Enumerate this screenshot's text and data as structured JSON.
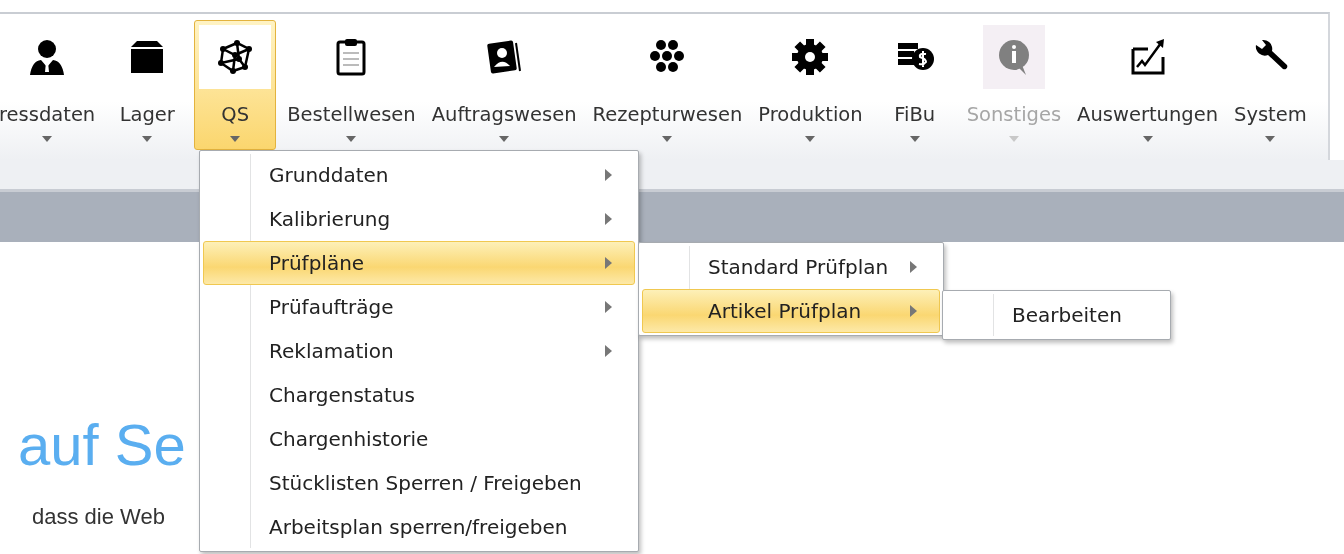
{
  "ribbon": {
    "items": [
      {
        "label": "ressdaten",
        "selected": false,
        "disabled": false
      },
      {
        "label": "Lager",
        "selected": false,
        "disabled": false
      },
      {
        "label": "QS",
        "selected": true,
        "disabled": false
      },
      {
        "label": "Bestellwesen",
        "selected": false,
        "disabled": false
      },
      {
        "label": "Auftragswesen",
        "selected": false,
        "disabled": false
      },
      {
        "label": "Rezepturwesen",
        "selected": false,
        "disabled": false
      },
      {
        "label": "Produktion",
        "selected": false,
        "disabled": false
      },
      {
        "label": "FiBu",
        "selected": false,
        "disabled": false
      },
      {
        "label": "Sonstiges",
        "selected": false,
        "disabled": true
      },
      {
        "label": "Auswertungen",
        "selected": false,
        "disabled": false
      },
      {
        "label": "System",
        "selected": false,
        "disabled": false
      }
    ]
  },
  "content": {
    "heading": "auf Se",
    "text": "dass die Web"
  },
  "menu": {
    "items": [
      {
        "label": "Grunddaten",
        "submenu": true,
        "selected": false
      },
      {
        "label": "Kalibrierung",
        "submenu": true,
        "selected": false
      },
      {
        "label": "Prüfpläne",
        "submenu": true,
        "selected": true
      },
      {
        "label": "Prüfaufträge",
        "submenu": true,
        "selected": false
      },
      {
        "label": "Reklamation",
        "submenu": true,
        "selected": false
      },
      {
        "label": "Chargenstatus",
        "submenu": false,
        "selected": false
      },
      {
        "label": "Chargenhistorie",
        "submenu": false,
        "selected": false
      },
      {
        "label": "Stücklisten Sperren / Freigeben",
        "submenu": false,
        "selected": false
      },
      {
        "label": "Arbeitsplan sperren/freigeben",
        "submenu": false,
        "selected": false
      }
    ]
  },
  "submenu": {
    "items": [
      {
        "label": "Standard Prüfplan",
        "submenu": true,
        "selected": false
      },
      {
        "label": "Artikel Prüfplan",
        "submenu": true,
        "selected": true
      }
    ]
  },
  "submenu_2": {
    "items": [
      {
        "label": "Bearbeiten",
        "submenu": false,
        "selected": false
      }
    ]
  }
}
